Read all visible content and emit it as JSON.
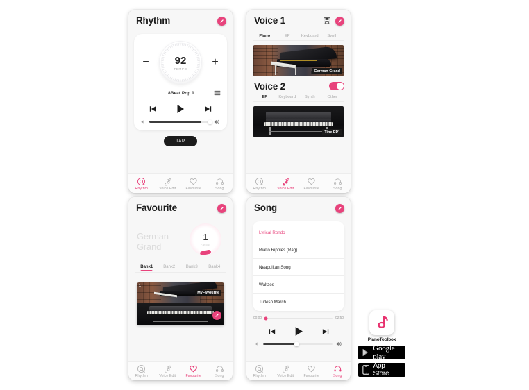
{
  "app": {
    "name": "PianoToolbox",
    "accent": "#e8437c",
    "store_badges": [
      {
        "label": "Google play",
        "icon": "google-play-triangle-icon"
      },
      {
        "label": "App Store",
        "icon": "apple-phone-icon"
      }
    ]
  },
  "nav": {
    "items": [
      {
        "label": "Rhythm",
        "icon": "rhythm-target-icon"
      },
      {
        "label": "Voice Edit",
        "icon": "note-pencil-icon"
      },
      {
        "label": "Favourite",
        "icon": "heart-icon"
      },
      {
        "label": "Song",
        "icon": "headphones-icon"
      }
    ]
  },
  "rhythm": {
    "title": "Rhythm",
    "edit_icon": "edit-pencil-icon",
    "minus": "−",
    "plus": "+",
    "tempo_value": "92",
    "tempo_label": "TEMPO",
    "style_name": "8Beat Pop 1",
    "list_icon": "list-menu-icon",
    "transport": {
      "prev_icon": "skip-previous-icon",
      "play_icon": "play-icon",
      "next_icon": "skip-next-icon"
    },
    "volume": {
      "low_icon": "volume-low-icon",
      "high_icon": "volume-high-icon",
      "value": 85
    },
    "tap_label": "TAP",
    "active_nav": "Rhythm"
  },
  "voice": {
    "title": "Voice 1",
    "save_icon": "save-floppy-icon",
    "edit_icon": "edit-pencil-icon",
    "voice1_tabs": [
      "Piano",
      "EP",
      "Keyboard",
      "Synth"
    ],
    "voice1_active_tab": "Piano",
    "voice1_image_caption": "German Grand",
    "title2": "Voice 2",
    "voice2_toggle": "on",
    "voice2_tabs": [
      "EP",
      "Keyboard",
      "Synth",
      "Other"
    ],
    "voice2_active_tab": "EP",
    "voice2_image_caption": "Tine EP1",
    "active_nav": "Voice Edit"
  },
  "favourite": {
    "title": "Favourite",
    "edit_icon": "edit-pencil-icon",
    "voice_name_line1": "German",
    "voice_name_line2": "Grand",
    "knob_number": "1",
    "knob_sublabel": "Favour",
    "banks": [
      "Bank1",
      "Bank2",
      "Bank3",
      "Bank4"
    ],
    "active_bank": "Bank1",
    "card_badge": "1",
    "card_caption": "MyFavourite",
    "card_fab_icon": "edit-pencil-icon",
    "active_nav": "Favourite"
  },
  "song": {
    "title": "Song",
    "edit_icon": "edit-pencil-icon",
    "songs": [
      "Lyrical Rondo",
      "Rialto Ripples (Rag)",
      "Neapolitan Song",
      "Waltzes",
      "Turkish March"
    ],
    "selected_song": "Lyrical Rondo",
    "time_current": "00:00",
    "time_total": "02:50",
    "transport": {
      "prev_icon": "skip-previous-icon",
      "play_icon": "play-icon",
      "next_icon": "skip-next-icon"
    },
    "volume": {
      "low_icon": "volume-low-icon",
      "high_icon": "volume-high-icon",
      "value": 48
    },
    "active_nav": "Song"
  }
}
